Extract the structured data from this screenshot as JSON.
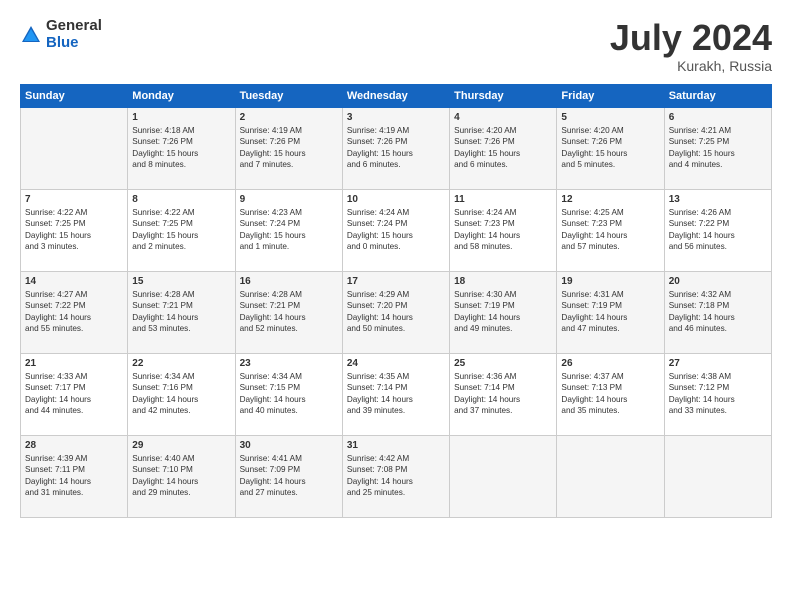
{
  "header": {
    "logo_general": "General",
    "logo_blue": "Blue",
    "title": "July 2024",
    "location": "Kurakh, Russia"
  },
  "days_of_week": [
    "Sunday",
    "Monday",
    "Tuesday",
    "Wednesday",
    "Thursday",
    "Friday",
    "Saturday"
  ],
  "weeks": [
    [
      {
        "day": "",
        "data": ""
      },
      {
        "day": "1",
        "data": "Sunrise: 4:18 AM\nSunset: 7:26 PM\nDaylight: 15 hours\nand 8 minutes."
      },
      {
        "day": "2",
        "data": "Sunrise: 4:19 AM\nSunset: 7:26 PM\nDaylight: 15 hours\nand 7 minutes."
      },
      {
        "day": "3",
        "data": "Sunrise: 4:19 AM\nSunset: 7:26 PM\nDaylight: 15 hours\nand 6 minutes."
      },
      {
        "day": "4",
        "data": "Sunrise: 4:20 AM\nSunset: 7:26 PM\nDaylight: 15 hours\nand 6 minutes."
      },
      {
        "day": "5",
        "data": "Sunrise: 4:20 AM\nSunset: 7:26 PM\nDaylight: 15 hours\nand 5 minutes."
      },
      {
        "day": "6",
        "data": "Sunrise: 4:21 AM\nSunset: 7:25 PM\nDaylight: 15 hours\nand 4 minutes."
      }
    ],
    [
      {
        "day": "7",
        "data": "Sunrise: 4:22 AM\nSunset: 7:25 PM\nDaylight: 15 hours\nand 3 minutes."
      },
      {
        "day": "8",
        "data": "Sunrise: 4:22 AM\nSunset: 7:25 PM\nDaylight: 15 hours\nand 2 minutes."
      },
      {
        "day": "9",
        "data": "Sunrise: 4:23 AM\nSunset: 7:24 PM\nDaylight: 15 hours\nand 1 minute."
      },
      {
        "day": "10",
        "data": "Sunrise: 4:24 AM\nSunset: 7:24 PM\nDaylight: 15 hours\nand 0 minutes."
      },
      {
        "day": "11",
        "data": "Sunrise: 4:24 AM\nSunset: 7:23 PM\nDaylight: 14 hours\nand 58 minutes."
      },
      {
        "day": "12",
        "data": "Sunrise: 4:25 AM\nSunset: 7:23 PM\nDaylight: 14 hours\nand 57 minutes."
      },
      {
        "day": "13",
        "data": "Sunrise: 4:26 AM\nSunset: 7:22 PM\nDaylight: 14 hours\nand 56 minutes."
      }
    ],
    [
      {
        "day": "14",
        "data": "Sunrise: 4:27 AM\nSunset: 7:22 PM\nDaylight: 14 hours\nand 55 minutes."
      },
      {
        "day": "15",
        "data": "Sunrise: 4:28 AM\nSunset: 7:21 PM\nDaylight: 14 hours\nand 53 minutes."
      },
      {
        "day": "16",
        "data": "Sunrise: 4:28 AM\nSunset: 7:21 PM\nDaylight: 14 hours\nand 52 minutes."
      },
      {
        "day": "17",
        "data": "Sunrise: 4:29 AM\nSunset: 7:20 PM\nDaylight: 14 hours\nand 50 minutes."
      },
      {
        "day": "18",
        "data": "Sunrise: 4:30 AM\nSunset: 7:19 PM\nDaylight: 14 hours\nand 49 minutes."
      },
      {
        "day": "19",
        "data": "Sunrise: 4:31 AM\nSunset: 7:19 PM\nDaylight: 14 hours\nand 47 minutes."
      },
      {
        "day": "20",
        "data": "Sunrise: 4:32 AM\nSunset: 7:18 PM\nDaylight: 14 hours\nand 46 minutes."
      }
    ],
    [
      {
        "day": "21",
        "data": "Sunrise: 4:33 AM\nSunset: 7:17 PM\nDaylight: 14 hours\nand 44 minutes."
      },
      {
        "day": "22",
        "data": "Sunrise: 4:34 AM\nSunset: 7:16 PM\nDaylight: 14 hours\nand 42 minutes."
      },
      {
        "day": "23",
        "data": "Sunrise: 4:34 AM\nSunset: 7:15 PM\nDaylight: 14 hours\nand 40 minutes."
      },
      {
        "day": "24",
        "data": "Sunrise: 4:35 AM\nSunset: 7:14 PM\nDaylight: 14 hours\nand 39 minutes."
      },
      {
        "day": "25",
        "data": "Sunrise: 4:36 AM\nSunset: 7:14 PM\nDaylight: 14 hours\nand 37 minutes."
      },
      {
        "day": "26",
        "data": "Sunrise: 4:37 AM\nSunset: 7:13 PM\nDaylight: 14 hours\nand 35 minutes."
      },
      {
        "day": "27",
        "data": "Sunrise: 4:38 AM\nSunset: 7:12 PM\nDaylight: 14 hours\nand 33 minutes."
      }
    ],
    [
      {
        "day": "28",
        "data": "Sunrise: 4:39 AM\nSunset: 7:11 PM\nDaylight: 14 hours\nand 31 minutes."
      },
      {
        "day": "29",
        "data": "Sunrise: 4:40 AM\nSunset: 7:10 PM\nDaylight: 14 hours\nand 29 minutes."
      },
      {
        "day": "30",
        "data": "Sunrise: 4:41 AM\nSunset: 7:09 PM\nDaylight: 14 hours\nand 27 minutes."
      },
      {
        "day": "31",
        "data": "Sunrise: 4:42 AM\nSunset: 7:08 PM\nDaylight: 14 hours\nand 25 minutes."
      },
      {
        "day": "",
        "data": ""
      },
      {
        "day": "",
        "data": ""
      },
      {
        "day": "",
        "data": ""
      }
    ]
  ]
}
